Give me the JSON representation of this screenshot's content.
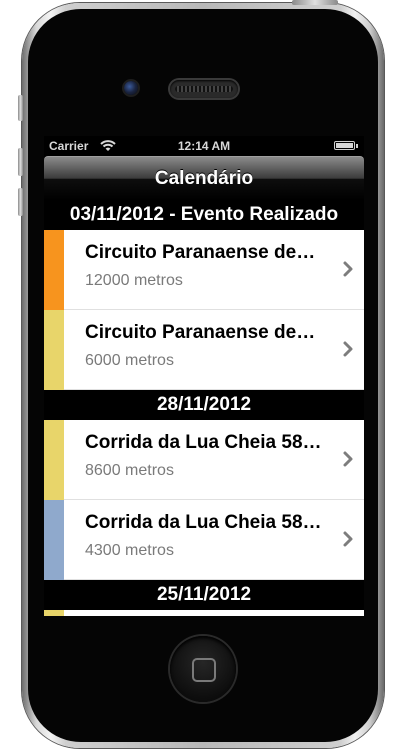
{
  "status_bar": {
    "carrier": "Carrier",
    "time": "12:14 AM"
  },
  "nav": {
    "title": "Calendário"
  },
  "sections": [
    {
      "header": "03/11/2012 - Evento Realizado",
      "items": [
        {
          "title": "Circuito Paranaense de…",
          "subtitle": "12000 metros",
          "color": "#F7941E"
        },
        {
          "title": "Circuito Paranaense de…",
          "subtitle": "6000 metros",
          "color": "#E8D56A"
        }
      ]
    },
    {
      "header": "28/11/2012",
      "items": [
        {
          "title": "Corrida da Lua Cheia 58…",
          "subtitle": "8600 metros",
          "color": "#E8D56A"
        },
        {
          "title": "Corrida da Lua Cheia 58…",
          "subtitle": "4300 metros",
          "color": "#8FA9CC"
        }
      ]
    },
    {
      "header": "25/11/2012",
      "items": [
        {
          "color": "#E8D56A"
        }
      ]
    }
  ],
  "icons": {
    "wifi": "wifi-icon",
    "battery": "battery-icon",
    "chevron": "chevron-right-icon"
  }
}
